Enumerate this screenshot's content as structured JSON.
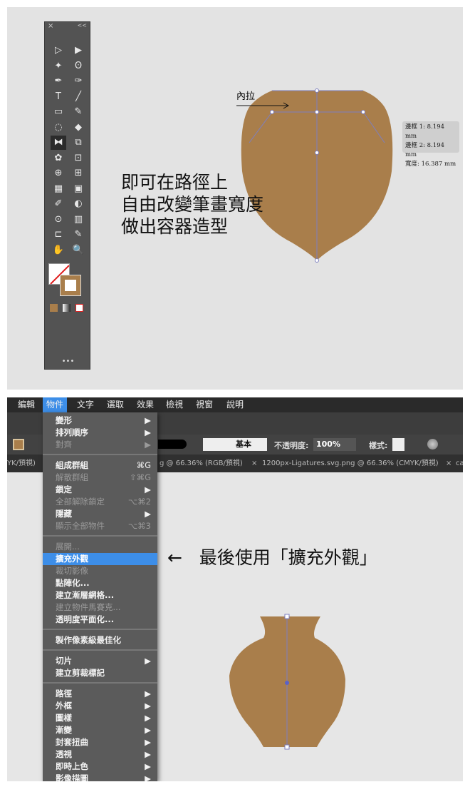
{
  "top_panel": {
    "annotation_label": "內拉",
    "caption_lines": [
      "即可在路徑上",
      "自由改變筆畫寬度",
      "做出容器造型"
    ],
    "tooltip": [
      "邊框 1: 8.194 mm",
      "邊框 2: 8.194 mm",
      "寬度: 16.387 mm"
    ],
    "shape_color": "#a97e4b",
    "tools_panel": {
      "close": "×",
      "collapse": "<<",
      "more": "•••"
    }
  },
  "bottom_panel": {
    "menubar": [
      "編輯",
      "物件",
      "文字",
      "選取",
      "效果",
      "檢視",
      "視窗",
      "說明"
    ],
    "active_menu": "物件",
    "control_bar": {
      "stroke_profile": "基本",
      "opacity_label": "不透明度:",
      "opacity_value": "100%",
      "style_label": "樣式:"
    },
    "tabs": [
      "YK/預視)",
      "g @ 66.36% (RGB/預視)",
      "1200px-Ligatures.svg.png @ 66.36% (CMYK/預視)",
      "ca"
    ],
    "menu_groups": [
      [
        {
          "label": "變形",
          "sub": "▶"
        },
        {
          "label": "排列順序",
          "sub": "▶"
        },
        {
          "label": "對齊",
          "sub": "▶",
          "disabled": true
        }
      ],
      [
        {
          "label": "組成群組",
          "sc": "⌘G"
        },
        {
          "label": "解散群組",
          "sc": "⇧⌘G",
          "disabled": true
        },
        {
          "label": "鎖定",
          "sub": "▶"
        },
        {
          "label": "全部解除鎖定",
          "sc": "⌥⌘2",
          "disabled": true
        },
        {
          "label": "隱藏",
          "sub": "▶"
        },
        {
          "label": "顯示全部物件",
          "sc": "⌥⌘3",
          "disabled": true
        }
      ],
      [
        {
          "label": "展開...",
          "disabled": true
        },
        {
          "label": "擴充外觀",
          "highlight": true
        },
        {
          "label": "裁切影像",
          "disabled": true
        },
        {
          "label": "點陣化..."
        },
        {
          "label": "建立漸層網格..."
        },
        {
          "label": "建立物件馬賽克...",
          "disabled": true
        },
        {
          "label": "透明度平面化..."
        }
      ],
      [
        {
          "label": "製作像素級最佳化"
        }
      ],
      [
        {
          "label": "切片",
          "sub": "▶"
        },
        {
          "label": "建立剪裁標記"
        }
      ],
      [
        {
          "label": "路徑",
          "sub": "▶"
        },
        {
          "label": "外框",
          "sub": "▶"
        },
        {
          "label": "圖樣",
          "sub": "▶"
        },
        {
          "label": "漸變",
          "sub": "▶"
        },
        {
          "label": "封套扭曲",
          "sub": "▶"
        },
        {
          "label": "透視",
          "sub": "▶"
        },
        {
          "label": "即時上色",
          "sub": "▶"
        },
        {
          "label": "影像描圖",
          "sub": "▶"
        }
      ]
    ],
    "caption": "最後使用「擴充外觀」",
    "caption_arrow": "←"
  }
}
